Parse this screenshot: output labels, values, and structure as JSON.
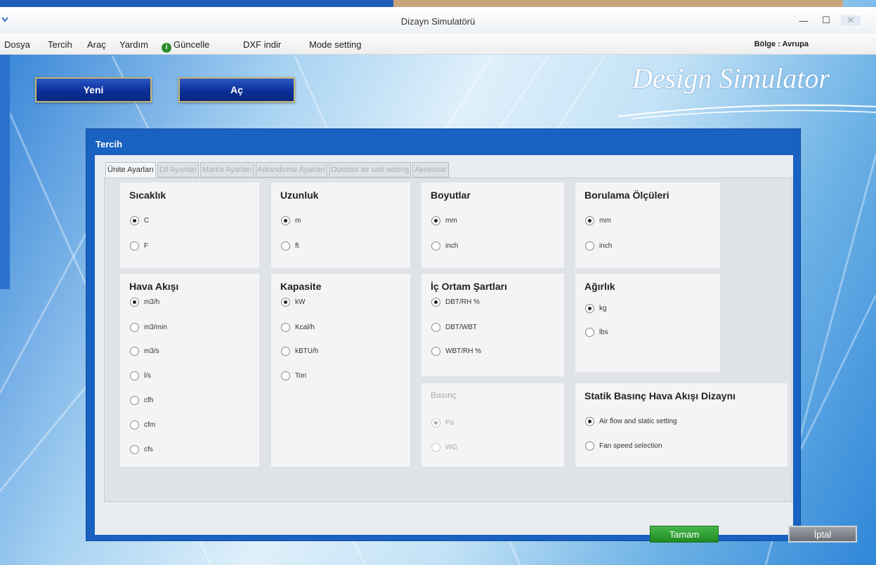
{
  "window": {
    "title": "Dizayn Simulatörü"
  },
  "menu": {
    "items": [
      "Dosya",
      "Tercih",
      "Araç",
      "Yardım",
      "Güncelle",
      "DXF indir",
      "Mode setting"
    ],
    "region": "Bölge : Avrupa"
  },
  "toolbar": {
    "new_label": "Yeni",
    "open_label": "Aç",
    "brand": "Design Simulator"
  },
  "dialog": {
    "title": "Tercih",
    "tabs": [
      "Ünite Ayarları",
      "Dil Ayarları",
      "Marka Ayarları",
      "Adlandırma Ayarları",
      "Outdoor air unit setting",
      "Aksesuar"
    ],
    "active_tab": 0,
    "groups": {
      "sicaklik": {
        "title": "Sıcaklık",
        "options": [
          "C",
          "F"
        ],
        "selected": 0
      },
      "uzunluk": {
        "title": "Uzunluk",
        "options": [
          "m",
          "ft"
        ],
        "selected": 0
      },
      "boyutlar": {
        "title": "Boyutlar",
        "options": [
          "mm",
          "inch"
        ],
        "selected": 0
      },
      "borulama": {
        "title": "Borulama Ölçüleri",
        "options": [
          "mm",
          "inch"
        ],
        "selected": 0
      },
      "hava_akisi": {
        "title": "Hava Akışı",
        "options": [
          "m3/h",
          "m3/min",
          "m3/s",
          "l/s",
          "cfh",
          "cfm",
          "cfs"
        ],
        "selected": 0
      },
      "kapasite": {
        "title": "Kapasite",
        "options": [
          "kW",
          "Kcal/h",
          "kBTU/h",
          "Ton"
        ],
        "selected": 0
      },
      "ic_ortam": {
        "title": "İç Ortam Şartları",
        "options": [
          "DBT/RH %",
          "DBT/WBT",
          "WBT/RH %"
        ],
        "selected": 0
      },
      "agirlik": {
        "title": "Ağırlık",
        "options": [
          "kg",
          "lbs"
        ],
        "selected": 0
      },
      "basinc": {
        "title": "Basınç",
        "options": [
          "Pa",
          "WG"
        ],
        "selected": 0
      },
      "statik": {
        "title": "Statik Basınç Hava Akışı  Dizaynı",
        "options": [
          "Air flow and static setting",
          "Fan speed selection"
        ],
        "selected": 0
      }
    },
    "ok_label": "Tamam",
    "cancel_label": "İptal"
  },
  "colors": {
    "dialog_blue": "#1962c2",
    "ok_green": "#2a9a2e",
    "button_blue": "#0b2f98"
  }
}
